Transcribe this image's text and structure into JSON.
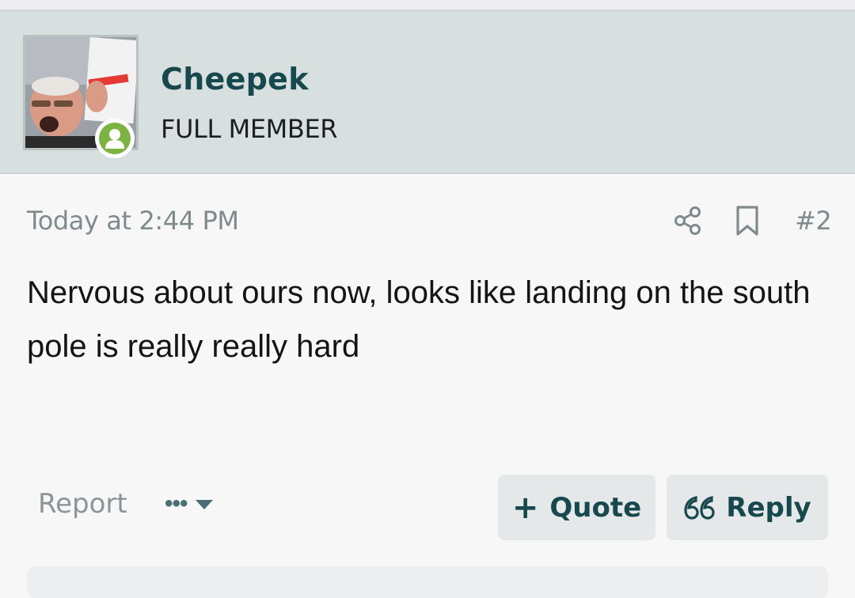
{
  "user": {
    "name": "Cheepek",
    "title": "FULL MEMBER",
    "status_color": "#7cb342"
  },
  "post": {
    "date": "Today at 2:44 PM",
    "number": "#2",
    "body": "Nervous about ours now, looks like landing on the south pole is really really hard"
  },
  "actions": {
    "share_icon": "share-icon",
    "bookmark_icon": "bookmark-icon",
    "report_label": "Report",
    "more_label": "•••",
    "quote_symbol": "+",
    "quote_label": "Quote",
    "reply_symbol": "66",
    "reply_label": "Reply"
  },
  "colors": {
    "header_bg": "#d8e0df",
    "accent": "#17484e",
    "button_bg": "#e5e8e9"
  }
}
